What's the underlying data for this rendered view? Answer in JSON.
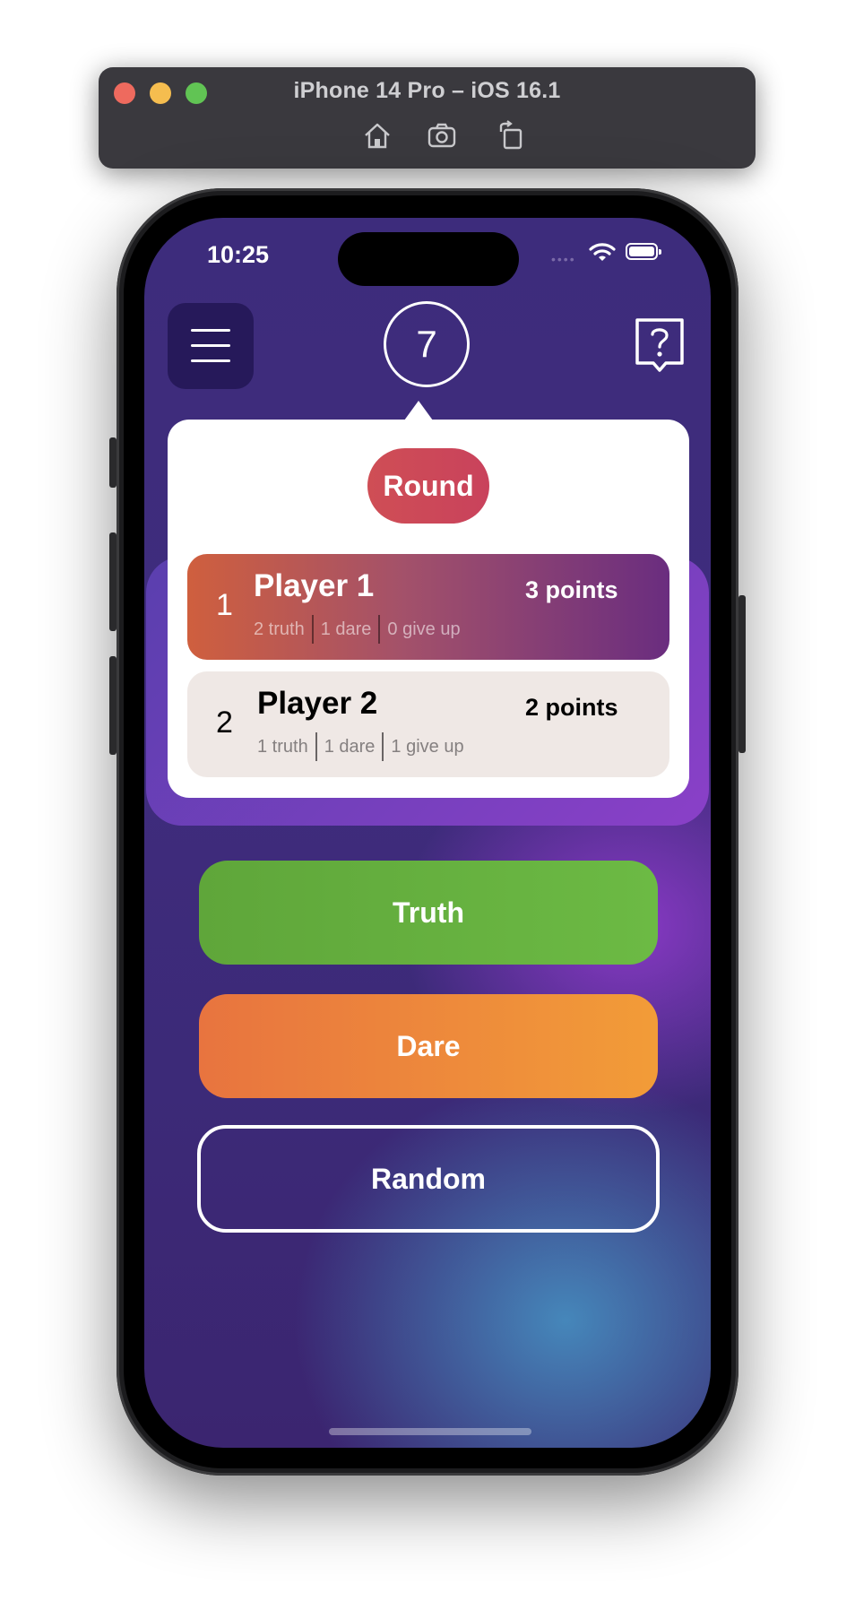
{
  "simulator": {
    "title": "iPhone 14 Pro – iOS 16.1",
    "toolbar_icons": [
      "home-icon",
      "screenshot-icon",
      "rotate-icon"
    ],
    "traffic_colors": [
      "#ee6a5e",
      "#f5bd4f",
      "#61c454"
    ]
  },
  "status_bar": {
    "time": "10:25",
    "dots": "••••",
    "icons": [
      "wifi-icon",
      "battery-icon"
    ]
  },
  "header": {
    "menu_icon": "hamburger-menu-icon",
    "round_number": "7",
    "help_icon": "help-bubble-icon"
  },
  "popover": {
    "round_label": "Round",
    "players": [
      {
        "rank": "1",
        "name": "Player 1",
        "points": "3 points",
        "truth": "2 truth",
        "dare": "1 dare",
        "give_up": "0 give up"
      },
      {
        "rank": "2",
        "name": "Player 2",
        "points": "2 points",
        "truth": "1 truth",
        "dare": "1 dare",
        "give_up": "1 give up"
      }
    ]
  },
  "actions": {
    "truth": "Truth",
    "dare": "Dare",
    "random": "Random"
  },
  "colors": {
    "background": "#3d2c7c",
    "truth": "#63ad3e",
    "dare": "#ee8a3b",
    "round_pill": "#cc4858",
    "leader_card": "#a3516a",
    "other_card": "#efe8e5"
  }
}
